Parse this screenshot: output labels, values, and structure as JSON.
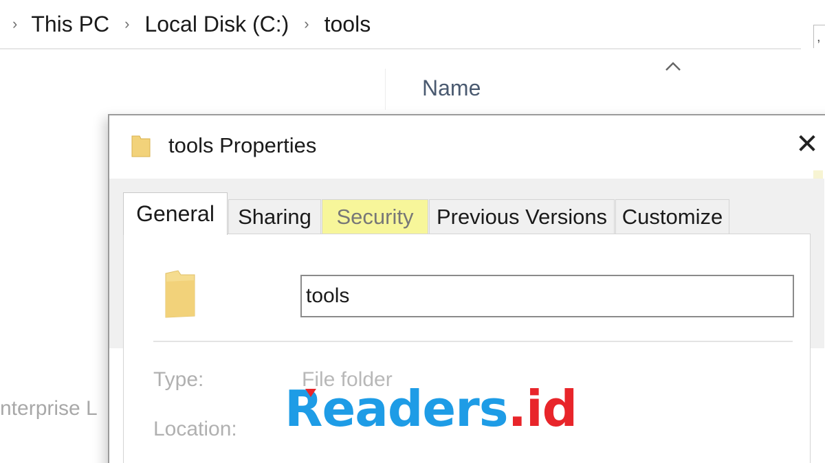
{
  "breadcrumb": {
    "items": [
      "This PC",
      "Local Disk (C:)",
      "tools"
    ]
  },
  "explorer": {
    "column_name": "Name",
    "side_text": "nterprise L"
  },
  "dialog": {
    "title": "tools Properties",
    "close_glyph": "✕",
    "tabs": [
      {
        "label": "General",
        "active": true
      },
      {
        "label": "Sharing",
        "active": false
      },
      {
        "label": "Security",
        "active": false,
        "highlighted": true
      },
      {
        "label": "Previous Versions",
        "active": false
      },
      {
        "label": "Customize",
        "active": false
      }
    ],
    "name_value": "tools",
    "properties": [
      {
        "label": "Type:",
        "value": "File folder"
      },
      {
        "label": "Location:",
        "value": ""
      }
    ]
  },
  "watermark": {
    "brand": "Readers",
    "tld": ".id",
    "colors": {
      "brand": "#1e9ce6",
      "tld": "#e8252a"
    }
  },
  "icons": {
    "breadcrumb_separator": "chevron-right-icon",
    "sort": "chevron-up-icon",
    "folder": "folder-icon",
    "close": "close-icon"
  },
  "colors": {
    "tab_highlight": "#f7f69a",
    "folder": "#f2d27a"
  }
}
